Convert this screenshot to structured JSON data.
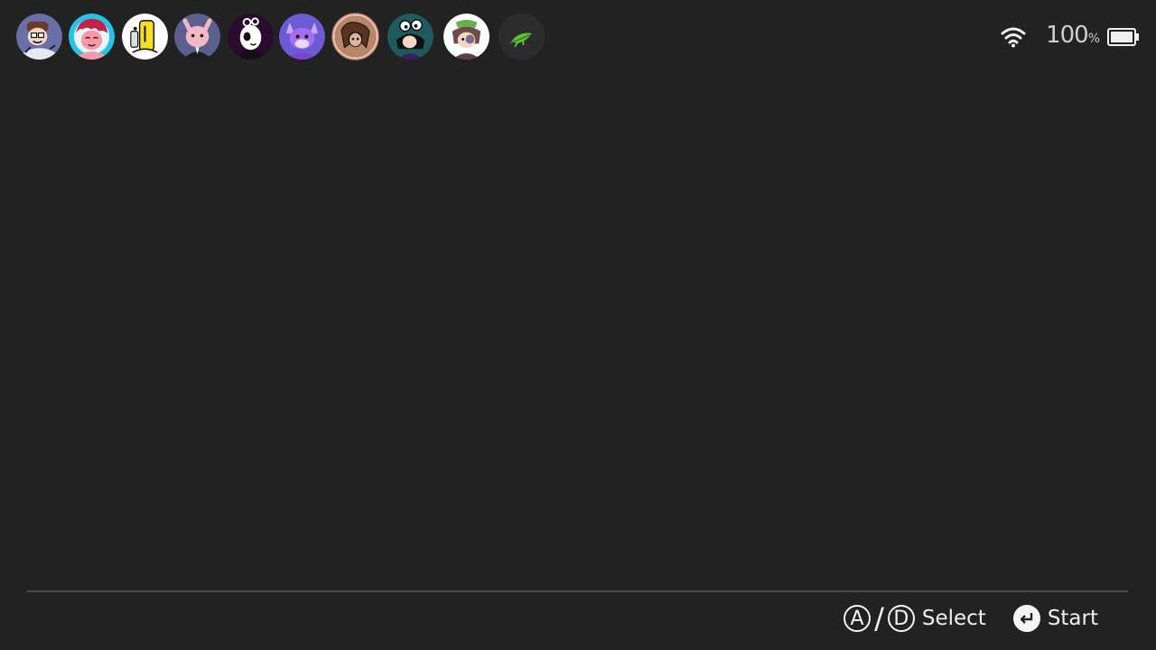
{
  "users": [
    {
      "name": "user-1",
      "bg": "#6a6fa8",
      "accent": "#6b3a2a",
      "selected": false
    },
    {
      "name": "user-2",
      "bg": "#27c3e6",
      "accent": "#c2214a",
      "selected": false
    },
    {
      "name": "user-3",
      "bg": "#ffffff",
      "accent": "#f4e020",
      "selected": false
    },
    {
      "name": "user-4",
      "bg": "#5c5f8e",
      "accent": "#f2b8c8",
      "selected": false
    },
    {
      "name": "user-5",
      "bg": "#2a0a2e",
      "accent": "#ffffff",
      "selected": false
    },
    {
      "name": "user-6",
      "bg": "#6d5bd6",
      "accent": "#a66df0",
      "selected": false
    },
    {
      "name": "user-7",
      "bg": "#b8866a",
      "accent": "#5a3220",
      "selected": true
    },
    {
      "name": "user-8",
      "bg": "#1f5a5c",
      "accent": "#111111",
      "selected": false
    },
    {
      "name": "user-9",
      "bg": "#ffffff",
      "accent": "#6e4a48",
      "selected": false
    }
  ],
  "add_user": {
    "icon": "leaf-icon",
    "color": "#5fbf3a"
  },
  "status": {
    "wifi_icon": "wifi-icon",
    "battery_value": "100",
    "battery_unit": "%",
    "battery_icon": "battery-full-icon"
  },
  "hints": {
    "button_a": "A",
    "slash": "/",
    "button_d": "D",
    "select_label": "Select",
    "start_icon": "enter-icon",
    "start_label": "Start"
  },
  "colors": {
    "background": "#222222",
    "text": "#f0f0f0",
    "divider": "#4a4a4a",
    "selected_ring": "#ebb6a0"
  }
}
